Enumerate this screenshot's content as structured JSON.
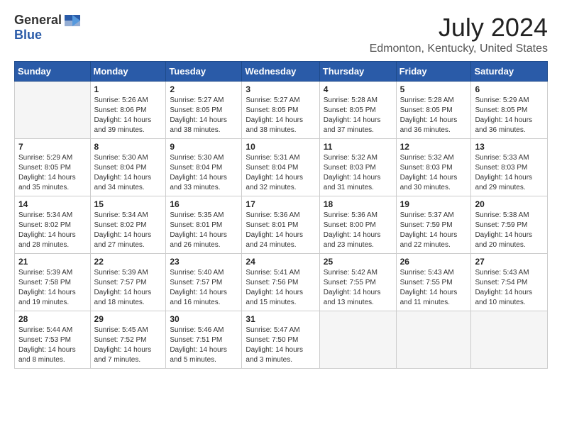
{
  "header": {
    "logo_general": "General",
    "logo_blue": "Blue",
    "title": "July 2024",
    "subtitle": "Edmonton, Kentucky, United States"
  },
  "calendar": {
    "days_of_week": [
      "Sunday",
      "Monday",
      "Tuesday",
      "Wednesday",
      "Thursday",
      "Friday",
      "Saturday"
    ],
    "weeks": [
      [
        {
          "day": "",
          "empty": true
        },
        {
          "day": "1",
          "sunrise": "5:26 AM",
          "sunset": "8:06 PM",
          "daylight": "14 hours and 39 minutes."
        },
        {
          "day": "2",
          "sunrise": "5:27 AM",
          "sunset": "8:05 PM",
          "daylight": "14 hours and 38 minutes."
        },
        {
          "day": "3",
          "sunrise": "5:27 AM",
          "sunset": "8:05 PM",
          "daylight": "14 hours and 38 minutes."
        },
        {
          "day": "4",
          "sunrise": "5:28 AM",
          "sunset": "8:05 PM",
          "daylight": "14 hours and 37 minutes."
        },
        {
          "day": "5",
          "sunrise": "5:28 AM",
          "sunset": "8:05 PM",
          "daylight": "14 hours and 36 minutes."
        },
        {
          "day": "6",
          "sunrise": "5:29 AM",
          "sunset": "8:05 PM",
          "daylight": "14 hours and 36 minutes."
        }
      ],
      [
        {
          "day": "7",
          "sunrise": "5:29 AM",
          "sunset": "8:05 PM",
          "daylight": "14 hours and 35 minutes."
        },
        {
          "day": "8",
          "sunrise": "5:30 AM",
          "sunset": "8:04 PM",
          "daylight": "14 hours and 34 minutes."
        },
        {
          "day": "9",
          "sunrise": "5:30 AM",
          "sunset": "8:04 PM",
          "daylight": "14 hours and 33 minutes."
        },
        {
          "day": "10",
          "sunrise": "5:31 AM",
          "sunset": "8:04 PM",
          "daylight": "14 hours and 32 minutes."
        },
        {
          "day": "11",
          "sunrise": "5:32 AM",
          "sunset": "8:03 PM",
          "daylight": "14 hours and 31 minutes."
        },
        {
          "day": "12",
          "sunrise": "5:32 AM",
          "sunset": "8:03 PM",
          "daylight": "14 hours and 30 minutes."
        },
        {
          "day": "13",
          "sunrise": "5:33 AM",
          "sunset": "8:03 PM",
          "daylight": "14 hours and 29 minutes."
        }
      ],
      [
        {
          "day": "14",
          "sunrise": "5:34 AM",
          "sunset": "8:02 PM",
          "daylight": "14 hours and 28 minutes."
        },
        {
          "day": "15",
          "sunrise": "5:34 AM",
          "sunset": "8:02 PM",
          "daylight": "14 hours and 27 minutes."
        },
        {
          "day": "16",
          "sunrise": "5:35 AM",
          "sunset": "8:01 PM",
          "daylight": "14 hours and 26 minutes."
        },
        {
          "day": "17",
          "sunrise": "5:36 AM",
          "sunset": "8:01 PM",
          "daylight": "14 hours and 24 minutes."
        },
        {
          "day": "18",
          "sunrise": "5:36 AM",
          "sunset": "8:00 PM",
          "daylight": "14 hours and 23 minutes."
        },
        {
          "day": "19",
          "sunrise": "5:37 AM",
          "sunset": "7:59 PM",
          "daylight": "14 hours and 22 minutes."
        },
        {
          "day": "20",
          "sunrise": "5:38 AM",
          "sunset": "7:59 PM",
          "daylight": "14 hours and 20 minutes."
        }
      ],
      [
        {
          "day": "21",
          "sunrise": "5:39 AM",
          "sunset": "7:58 PM",
          "daylight": "14 hours and 19 minutes."
        },
        {
          "day": "22",
          "sunrise": "5:39 AM",
          "sunset": "7:57 PM",
          "daylight": "14 hours and 18 minutes."
        },
        {
          "day": "23",
          "sunrise": "5:40 AM",
          "sunset": "7:57 PM",
          "daylight": "14 hours and 16 minutes."
        },
        {
          "day": "24",
          "sunrise": "5:41 AM",
          "sunset": "7:56 PM",
          "daylight": "14 hours and 15 minutes."
        },
        {
          "day": "25",
          "sunrise": "5:42 AM",
          "sunset": "7:55 PM",
          "daylight": "14 hours and 13 minutes."
        },
        {
          "day": "26",
          "sunrise": "5:43 AM",
          "sunset": "7:55 PM",
          "daylight": "14 hours and 11 minutes."
        },
        {
          "day": "27",
          "sunrise": "5:43 AM",
          "sunset": "7:54 PM",
          "daylight": "14 hours and 10 minutes."
        }
      ],
      [
        {
          "day": "28",
          "sunrise": "5:44 AM",
          "sunset": "7:53 PM",
          "daylight": "14 hours and 8 minutes."
        },
        {
          "day": "29",
          "sunrise": "5:45 AM",
          "sunset": "7:52 PM",
          "daylight": "14 hours and 7 minutes."
        },
        {
          "day": "30",
          "sunrise": "5:46 AM",
          "sunset": "7:51 PM",
          "daylight": "14 hours and 5 minutes."
        },
        {
          "day": "31",
          "sunrise": "5:47 AM",
          "sunset": "7:50 PM",
          "daylight": "14 hours and 3 minutes."
        },
        {
          "day": "",
          "empty": true
        },
        {
          "day": "",
          "empty": true
        },
        {
          "day": "",
          "empty": true
        }
      ]
    ]
  }
}
